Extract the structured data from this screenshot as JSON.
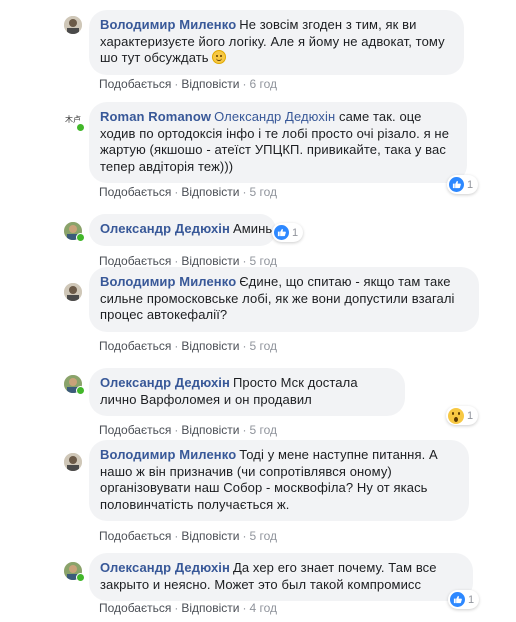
{
  "comments": [
    {
      "author": "Володимир Миленко",
      "text": "Не зовсім згоден з тим, як ви характеризуєте його логіку. Але я йому не адвокат, тому шо тут обсуждать",
      "emoji": "smile-emoji",
      "like": "Подобається",
      "reply": "Відповісти",
      "time": "6 год"
    },
    {
      "author": "Roman Romanow",
      "mention": "Олександр Дедюхін",
      "text": "саме так. оце ходив по ортодоксія інфо і те лобі просто очі різало. я не жартую (якшошо - атеїст УПЦКП. привикайте, така у вас тепер авдіторія теж)))",
      "like": "Подобається",
      "reply": "Відповісти",
      "time": "5 год",
      "reaction_count": "1",
      "reaction": "like-icon"
    },
    {
      "author": "Олександр Дедюхін",
      "text": "Аминь",
      "like": "Подобається",
      "reply": "Відповісти",
      "time": "5 год",
      "reaction_count": "1",
      "reaction": "like-icon"
    },
    {
      "author": "Володимир Миленко",
      "text": "Єдине, що спитаю - якщо там таке сильне промосковське лобі, як же вони допустили взагалі процес автокефалії?",
      "like": "Подобається",
      "reply": "Відповісти",
      "time": "5 год"
    },
    {
      "author": "Олександр Дедюхін",
      "text": "Просто Мск достала лично Варфоломея и он продавил",
      "like": "Подобається",
      "reply": "Відповісти",
      "time": "5 год",
      "reaction_count": "1",
      "reaction": "wow-icon"
    },
    {
      "author": "Володимир Миленко",
      "text": "Тоді у мене наступне питання. А нашо ж він призначив (чи сопротівлявся оному) організовувати наш Собор - москвофіла? Ну от якась половинчатість получається ж.",
      "like": "Подобається",
      "reply": "Відповісти",
      "time": "5 год"
    },
    {
      "author": "Олександр Дедюхін",
      "text": "Да хер его знает почему. Там все закрыто и неясно. Может это был такой компромисс",
      "like": "Подобається",
      "reply": "Відповісти",
      "time": "4 год",
      "reaction_count": "1",
      "reaction": "like-icon"
    }
  ]
}
